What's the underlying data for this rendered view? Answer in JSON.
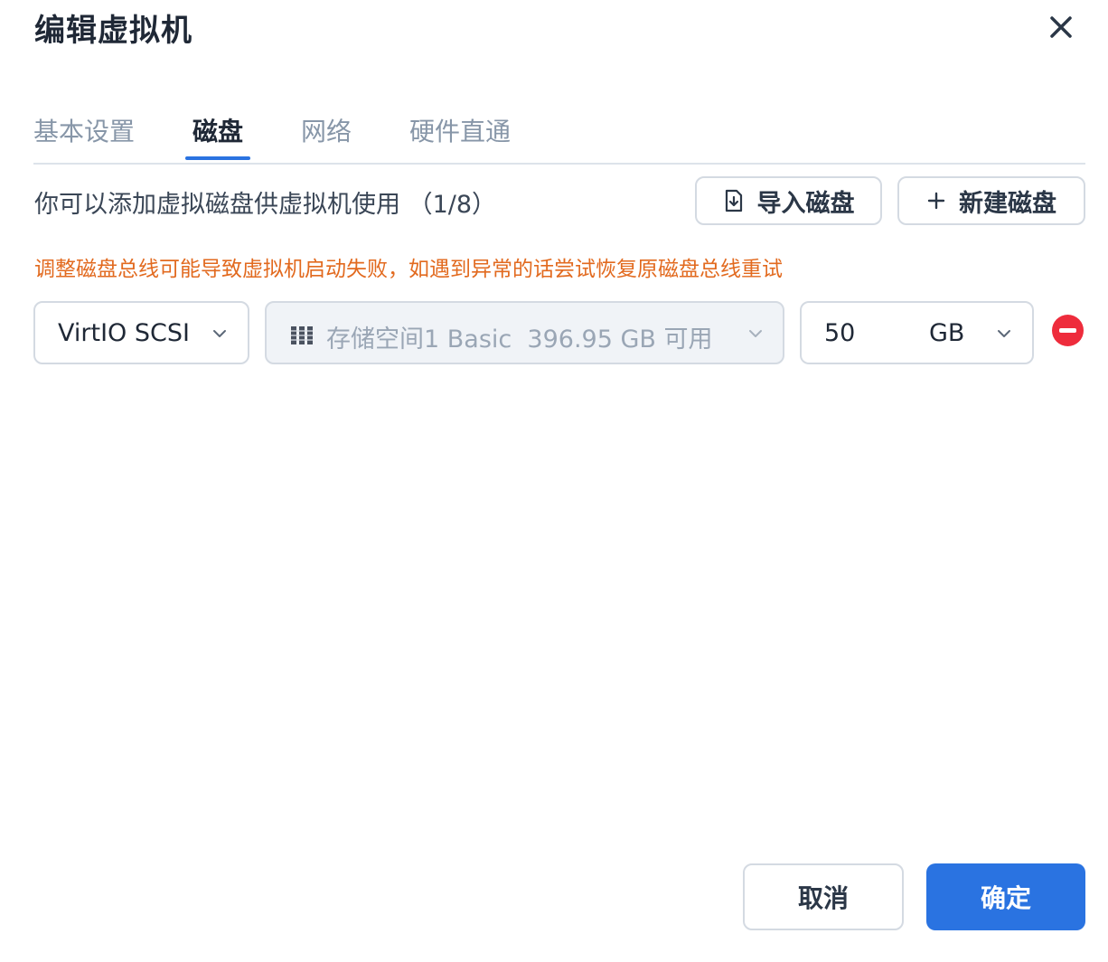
{
  "dialog": {
    "title": "编辑虚拟机",
    "close_icon": "close-icon"
  },
  "tabs": [
    {
      "label": "基本设置",
      "active": false
    },
    {
      "label": "磁盘",
      "active": true
    },
    {
      "label": "网络",
      "active": false
    },
    {
      "label": "硬件直通",
      "active": false
    }
  ],
  "disk_panel": {
    "description": "你可以添加虚拟磁盘供虚拟机使用 （1/8）",
    "import_button": {
      "label": "导入磁盘",
      "icon": "import-file-icon"
    },
    "new_button": {
      "label": "新建磁盘",
      "icon": "plus-icon"
    },
    "warning": "调整磁盘总线可能导致虚拟机启动失败，如遇到异常的话尝试恢复原磁盘总线重试",
    "warning_color": "#e26a1f"
  },
  "disk_row": {
    "bus": {
      "value": "VirtIO SCSI"
    },
    "storage": {
      "icon": "storage-volume-icon",
      "value": "存储空间1 Basic  396.95 GB 可用",
      "disabled": true
    },
    "size": {
      "value": "50",
      "unit": "GB"
    },
    "remove_icon": "remove-circle-icon"
  },
  "footer": {
    "cancel_label": "取消",
    "confirm_label": "确定"
  },
  "colors": {
    "accent": "#2a73e1",
    "danger": "#ee2c3c"
  }
}
